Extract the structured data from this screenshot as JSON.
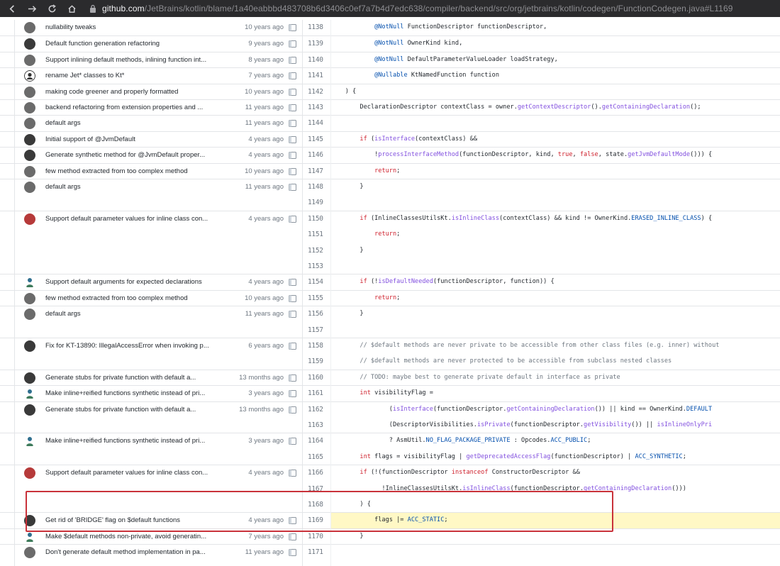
{
  "browser": {
    "url_host": "github.com",
    "url_path": "/JetBrains/kotlin/blame/1a40eabbbd483708b6d3406c0ef7a7b4d7edc638/compiler/backend/src/org/jetbrains/kotlin/codegen/FunctionCodegen.java#L1169"
  },
  "groups": [
    {
      "message": "nullability tweaks",
      "age": "10 years ago",
      "avatar": "a2",
      "lines": [
        1138
      ]
    },
    {
      "message": "Default function generation refactoring",
      "age": "9 years ago",
      "avatar": "a3",
      "lines": [
        1139
      ]
    },
    {
      "message": "Support inlining default methods, inlining function int...",
      "age": "8 years ago",
      "avatar": "a2",
      "lines": [
        1140
      ]
    },
    {
      "message": "rename Jet* classes to Kt*",
      "age": "7 years ago",
      "avatar": "person",
      "lines": [
        1141
      ]
    },
    {
      "message": "making code greener and properly formatted",
      "age": "10 years ago",
      "avatar": "a2",
      "lines": [
        1142
      ]
    },
    {
      "message": "backend refactoring from extension properties and ...",
      "age": "11 years ago",
      "avatar": "a2",
      "lines": [
        1143
      ]
    },
    {
      "message": "default args",
      "age": "11 years ago",
      "avatar": "a2",
      "lines": [
        1144
      ]
    },
    {
      "message": "Initial support of @JvmDefault",
      "age": "4 years ago",
      "avatar": "a3",
      "lines": [
        1145
      ]
    },
    {
      "message": "Generate synthetic method for @JvmDefault proper...",
      "age": "4 years ago",
      "avatar": "a3",
      "lines": [
        1146
      ]
    },
    {
      "message": "few method extracted from too complex method",
      "age": "10 years ago",
      "avatar": "a2",
      "lines": [
        1147
      ]
    },
    {
      "message": "default args",
      "age": "11 years ago",
      "avatar": "a2",
      "lines": [
        1148,
        1149
      ]
    },
    {
      "message": "Support default parameter values for inline class con...",
      "age": "4 years ago",
      "avatar": "red",
      "lines": [
        1150,
        1151,
        1152,
        1153
      ]
    },
    {
      "message": "Support default arguments for expected declarations",
      "age": "4 years ago",
      "avatar": "person2",
      "lines": [
        1154
      ]
    },
    {
      "message": "few method extracted from too complex method",
      "age": "10 years ago",
      "avatar": "a2",
      "lines": [
        1155
      ]
    },
    {
      "message": "default args",
      "age": "11 years ago",
      "avatar": "a2",
      "lines": [
        1156,
        1157
      ]
    },
    {
      "message": "Fix for KT-13890: IllegalAccessError when invoking p...",
      "age": "6 years ago",
      "avatar": "a3",
      "lines": [
        1158,
        1159
      ]
    },
    {
      "message": "Generate stubs for private function with default a...",
      "age": "13 months ago",
      "avatar": "a3",
      "lines": [
        1160
      ]
    },
    {
      "message": "Make inline+reified functions synthetic instead of pri...",
      "age": "3 years ago",
      "avatar": "person2",
      "lines": [
        1161
      ]
    },
    {
      "message": "Generate stubs for private function with default a...",
      "age": "13 months ago",
      "avatar": "a3",
      "lines": [
        1162,
        1163
      ]
    },
    {
      "message": "Make inline+reified functions synthetic instead of pri...",
      "age": "3 years ago",
      "avatar": "person2",
      "lines": [
        1164,
        1165
      ]
    },
    {
      "message": "Support default parameter values for inline class con...",
      "age": "4 years ago",
      "avatar": "red",
      "lines": [
        1166,
        1167,
        1168
      ]
    },
    {
      "message": "Get rid of 'BRIDGE' flag on $default functions",
      "age": "4 years ago",
      "avatar": "a3",
      "lines": [
        1169
      ]
    },
    {
      "message": "Make $default methods non-private, avoid generatin...",
      "age": "7 years ago",
      "avatar": "person2",
      "lines": [
        1170
      ]
    },
    {
      "message": "Don't generate default method implementation in pa...",
      "age": "11 years ago",
      "avatar": "a2",
      "lines": [
        1171
      ]
    }
  ],
  "code": {
    "1138": [
      [
        "anno",
        "            @NotNull"
      ],
      [
        "",
        " FunctionDescriptor functionDescriptor,"
      ]
    ],
    "1139": [
      [
        "anno",
        "            @NotNull"
      ],
      [
        "",
        " OwnerKind kind,"
      ]
    ],
    "1140": [
      [
        "anno",
        "            @NotNull"
      ],
      [
        "",
        " DefaultParameterValueLoader loadStrategy,"
      ]
    ],
    "1141": [
      [
        "anno",
        "            @Nullable"
      ],
      [
        "",
        " KtNamedFunction function"
      ]
    ],
    "1142": [
      [
        "",
        "    ) {"
      ]
    ],
    "1143": [
      [
        "",
        "        DeclarationDescriptor contextClass = owner."
      ],
      [
        "fn",
        "getContextDescriptor"
      ],
      [
        "",
        "()."
      ],
      [
        "fn",
        "getContainingDeclaration"
      ],
      [
        "",
        "();"
      ]
    ],
    "1144": [
      [
        "",
        ""
      ]
    ],
    "1145": [
      [
        "",
        "        "
      ],
      [
        "kw",
        "if"
      ],
      [
        "",
        " ("
      ],
      [
        "fn",
        "isInterface"
      ],
      [
        "",
        "(contextClass) &&"
      ]
    ],
    "1146": [
      [
        "",
        "            !"
      ],
      [
        "fn",
        "processInterfaceMethod"
      ],
      [
        "",
        "(functionDescriptor, kind, "
      ],
      [
        "kw",
        "true"
      ],
      [
        "",
        ", "
      ],
      [
        "kw",
        "false"
      ],
      [
        "",
        ", state."
      ],
      [
        "fn",
        "getJvmDefaultMode"
      ],
      [
        "",
        "())) {"
      ]
    ],
    "1147": [
      [
        "",
        "            "
      ],
      [
        "kw",
        "return"
      ],
      [
        "",
        ";"
      ]
    ],
    "1148": [
      [
        "",
        "        }"
      ]
    ],
    "1149": [
      [
        "",
        ""
      ]
    ],
    "1150": [
      [
        "",
        "        "
      ],
      [
        "kw",
        "if"
      ],
      [
        "",
        " (InlineClassesUtilsKt."
      ],
      [
        "fn",
        "isInlineClass"
      ],
      [
        "",
        "(contextClass) && kind != OwnerKind."
      ],
      [
        "const",
        "ERASED_INLINE_CLASS"
      ],
      [
        "",
        ") {"
      ]
    ],
    "1151": [
      [
        "",
        "            "
      ],
      [
        "kw",
        "return"
      ],
      [
        "",
        ";"
      ]
    ],
    "1152": [
      [
        "",
        "        }"
      ]
    ],
    "1153": [
      [
        "",
        ""
      ]
    ],
    "1154": [
      [
        "",
        "        "
      ],
      [
        "kw",
        "if"
      ],
      [
        "",
        " (!"
      ],
      [
        "fn",
        "isDefaultNeeded"
      ],
      [
        "",
        "(functionDescriptor, function)) {"
      ]
    ],
    "1155": [
      [
        "",
        "            "
      ],
      [
        "kw",
        "return"
      ],
      [
        "",
        ";"
      ]
    ],
    "1156": [
      [
        "",
        "        }"
      ]
    ],
    "1157": [
      [
        "",
        ""
      ]
    ],
    "1158": [
      [
        "cm",
        "        // $default methods are never private to be accessible from other class files (e.g. inner) without"
      ]
    ],
    "1159": [
      [
        "cm",
        "        // $default methods are never protected to be accessible from subclass nested classes"
      ]
    ],
    "1160": [
      [
        "cm",
        "        // TODO: maybe best to generate private default in interface as private"
      ]
    ],
    "1161": [
      [
        "",
        "        "
      ],
      [
        "kw",
        "int"
      ],
      [
        "",
        " visibilityFlag ="
      ]
    ],
    "1162": [
      [
        "",
        "                ("
      ],
      [
        "fn",
        "isInterface"
      ],
      [
        "",
        "(functionDescriptor."
      ],
      [
        "fn",
        "getContainingDeclaration"
      ],
      [
        "",
        "()) || kind == OwnerKind."
      ],
      [
        "const",
        "DEFAULT"
      ]
    ],
    "1163": [
      [
        "",
        "                (DescriptorVisibilities."
      ],
      [
        "fn",
        "isPrivate"
      ],
      [
        "",
        "(functionDescriptor."
      ],
      [
        "fn",
        "getVisibility"
      ],
      [
        "",
        "()) || "
      ],
      [
        "fn",
        "isInlineOnlyPri"
      ]
    ],
    "1164": [
      [
        "",
        "                ? AsmUtil."
      ],
      [
        "const",
        "NO_FLAG_PACKAGE_PRIVATE"
      ],
      [
        "",
        " : Opcodes."
      ],
      [
        "const",
        "ACC_PUBLIC"
      ],
      [
        "",
        ";"
      ]
    ],
    "1165": [
      [
        "",
        "        "
      ],
      [
        "kw",
        "int"
      ],
      [
        "",
        " flags = visibilityFlag | "
      ],
      [
        "fn",
        "getDeprecatedAccessFlag"
      ],
      [
        "",
        "(functionDescriptor) | "
      ],
      [
        "const",
        "ACC_SYNTHETIC"
      ],
      [
        "",
        ";"
      ]
    ],
    "1166": [
      [
        "",
        "        "
      ],
      [
        "kw",
        "if"
      ],
      [
        "",
        " (!(functionDescriptor "
      ],
      [
        "kw",
        "instanceof"
      ],
      [
        "",
        " ConstructorDescriptor &&"
      ]
    ],
    "1167": [
      [
        "",
        "              !InlineClassesUtilsKt."
      ],
      [
        "fn",
        "isInlineClass"
      ],
      [
        "",
        "(functionDescriptor."
      ],
      [
        "fn",
        "getContainingDeclaration"
      ],
      [
        "",
        "()))"
      ]
    ],
    "1168": [
      [
        "",
        "        ) {"
      ]
    ],
    "1169": [
      [
        "",
        "            flags |= "
      ],
      [
        "const",
        "ACC_STATIC"
      ],
      [
        "",
        ";"
      ]
    ],
    "1170": [
      [
        "",
        "        }"
      ]
    ],
    "1171": [
      [
        "",
        ""
      ]
    ]
  }
}
